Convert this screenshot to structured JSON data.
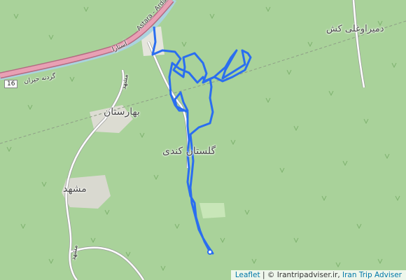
{
  "map": {
    "labels": {
      "damiraoghli_kesh": "دمیراوغلی کش",
      "baharestan": "بهارستان",
      "golestan_kandi": "گلستان کندی",
      "mashad": "مشهد",
      "road_astara_top": "Astara - Ardabil",
      "road_astara_label": "آستارا",
      "road_side_label": "مشهد",
      "road_bottom_label": "مشهد",
      "gardane_heyran": "گردنه حیران",
      "road_number": "16"
    },
    "attribution": {
      "leaflet": "Leaflet",
      "separator": " | © ",
      "site": "Irantripadviser.ir",
      "comma": ", ",
      "brand": "Iran Trip Adviser"
    },
    "colors": {
      "forest": "#a9d29a",
      "track": "#2a6ef0",
      "road_main": "#e8a0b4",
      "road_minor": "#ffffff",
      "river": "#aad3df"
    }
  }
}
